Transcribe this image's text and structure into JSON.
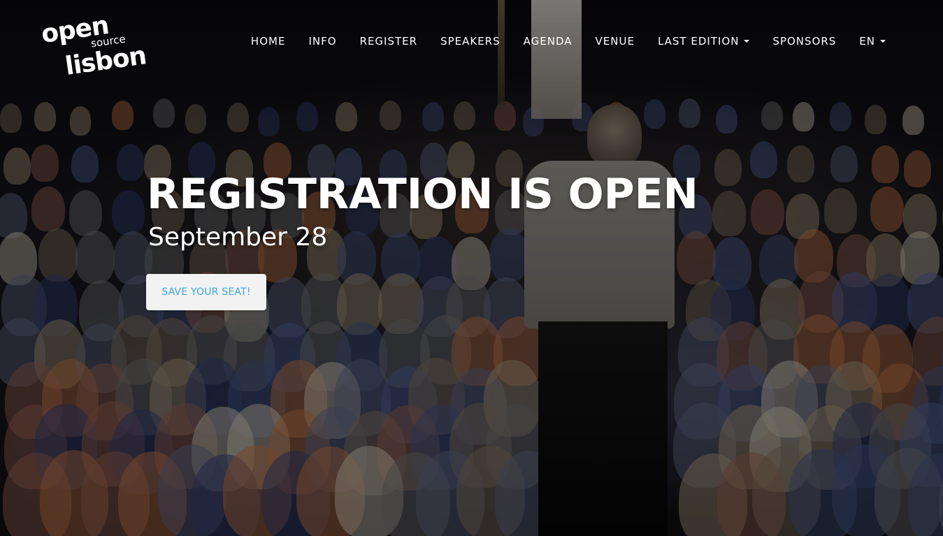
{
  "brand": {
    "logo_open": "open",
    "logo_source": "source",
    "logo_lisbon": "lisbon"
  },
  "nav": {
    "items": [
      {
        "label": "HOME",
        "dropdown": false
      },
      {
        "label": "INFO",
        "dropdown": false
      },
      {
        "label": "REGISTER",
        "dropdown": false
      },
      {
        "label": "SPEAKERS",
        "dropdown": false
      },
      {
        "label": "AGENDA",
        "dropdown": false
      },
      {
        "label": "VENUE",
        "dropdown": false
      },
      {
        "label": "LAST EDITION",
        "dropdown": true
      },
      {
        "label": "SPONSORS",
        "dropdown": false
      },
      {
        "label": "EN",
        "dropdown": true
      }
    ]
  },
  "hero": {
    "title": "REGISTRATION IS OPEN",
    "date": "September 28",
    "cta_label": "SAVE YOUR SEAT!"
  },
  "colors": {
    "cta_text": "#3fa7d6",
    "cta_bg": "#f2f2f2",
    "text": "#ffffff"
  }
}
